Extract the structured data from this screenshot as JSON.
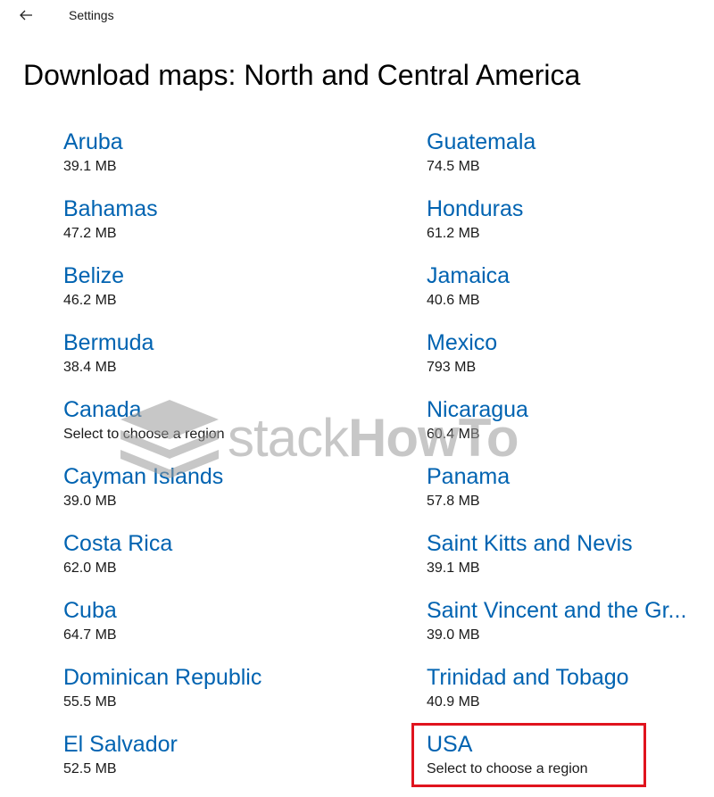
{
  "app": {
    "title": "Settings",
    "back_icon": "arrow-left-icon"
  },
  "page": {
    "title": "Download maps: North and Central America"
  },
  "regions_left": [
    {
      "name": "Aruba",
      "size": "39.1 MB"
    },
    {
      "name": "Bahamas",
      "size": "47.2 MB"
    },
    {
      "name": "Belize",
      "size": "46.2 MB"
    },
    {
      "name": "Bermuda",
      "size": "38.4 MB"
    },
    {
      "name": "Canada",
      "size": "Select to choose a region"
    },
    {
      "name": "Cayman Islands",
      "size": "39.0 MB"
    },
    {
      "name": "Costa Rica",
      "size": "62.0 MB"
    },
    {
      "name": "Cuba",
      "size": "64.7 MB"
    },
    {
      "name": "Dominican Republic",
      "size": "55.5 MB"
    },
    {
      "name": "El Salvador",
      "size": "52.5 MB"
    }
  ],
  "regions_right": [
    {
      "name": "Guatemala",
      "size": "74.5 MB"
    },
    {
      "name": "Honduras",
      "size": "61.2 MB"
    },
    {
      "name": "Jamaica",
      "size": "40.6 MB"
    },
    {
      "name": "Mexico",
      "size": "793 MB"
    },
    {
      "name": "Nicaragua",
      "size": "60.4 MB"
    },
    {
      "name": "Panama",
      "size": "57.8 MB"
    },
    {
      "name": "Saint Kitts and Nevis",
      "size": "39.1 MB"
    },
    {
      "name": "Saint Vincent and the Gr...",
      "size": "39.0 MB"
    },
    {
      "name": "Trinidad and Tobago",
      "size": "40.9 MB"
    },
    {
      "name": "USA",
      "size": "Select to choose a region"
    }
  ],
  "colors": {
    "link": "#0063b1",
    "highlight": "#e0141e",
    "watermark": "#9b9b9b"
  },
  "watermark": {
    "text_light": "stack",
    "text_strong": "HowTo"
  }
}
